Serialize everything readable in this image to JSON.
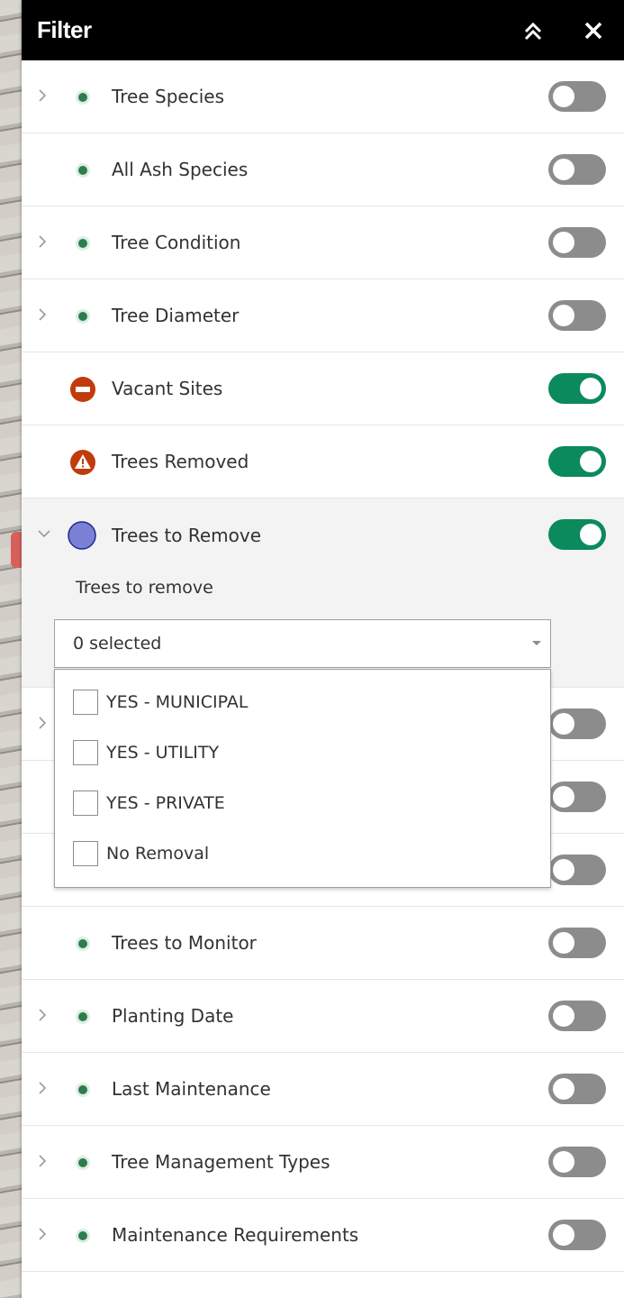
{
  "header": {
    "title": "Filter"
  },
  "rows": [
    {
      "label": "Tree Species",
      "expandable": true,
      "icon": "green-dot-icon",
      "on": false
    },
    {
      "label": "All Ash Species",
      "expandable": false,
      "icon": "green-dot-icon",
      "on": false
    },
    {
      "label": "Tree Condition",
      "expandable": true,
      "icon": "green-dot-icon",
      "on": false
    },
    {
      "label": "Tree Diameter",
      "expandable": true,
      "icon": "green-dot-icon",
      "on": false
    },
    {
      "label": "Vacant Sites",
      "expandable": false,
      "icon": "no-entry-icon",
      "on": true
    },
    {
      "label": "Trees Removed",
      "expandable": false,
      "icon": "warning-icon",
      "on": true
    },
    {
      "label": "Trees to Remove",
      "expandable": true,
      "expanded": true,
      "icon": "purple-circle-icon",
      "on": true
    },
    {
      "label": "",
      "expandable": true,
      "icon": "green-dot-icon",
      "on": false
    },
    {
      "label": "",
      "expandable": false,
      "icon": "green-dot-icon",
      "on": false
    },
    {
      "label": "",
      "expandable": false,
      "icon": "green-dot-icon",
      "on": false
    },
    {
      "label": "Trees to Monitor",
      "expandable": false,
      "icon": "green-dot-icon",
      "on": false
    },
    {
      "label": "Planting Date",
      "expandable": true,
      "icon": "green-dot-icon",
      "on": false
    },
    {
      "label": "Last Maintenance",
      "expandable": true,
      "icon": "green-dot-icon",
      "on": false
    },
    {
      "label": "Tree Management Types",
      "expandable": true,
      "icon": "green-dot-icon",
      "on": false
    },
    {
      "label": "Maintenance Requirements",
      "expandable": true,
      "icon": "green-dot-icon",
      "on": false
    }
  ],
  "trees_to_remove": {
    "sub_label": "Trees to remove",
    "select_value": "0 selected",
    "options": [
      "YES - MUNICIPAL",
      "YES - UTILITY",
      "YES - PRIVATE",
      "No Removal"
    ]
  },
  "colors": {
    "header_bg": "#000000",
    "toggle_on": "#0b8a5c",
    "toggle_off": "#8c8c8c",
    "green_dot": "#2e7d4f",
    "no_entry": "#c23b0c",
    "warning": "#c23b0c",
    "purple_circle": "#7b80d6"
  }
}
